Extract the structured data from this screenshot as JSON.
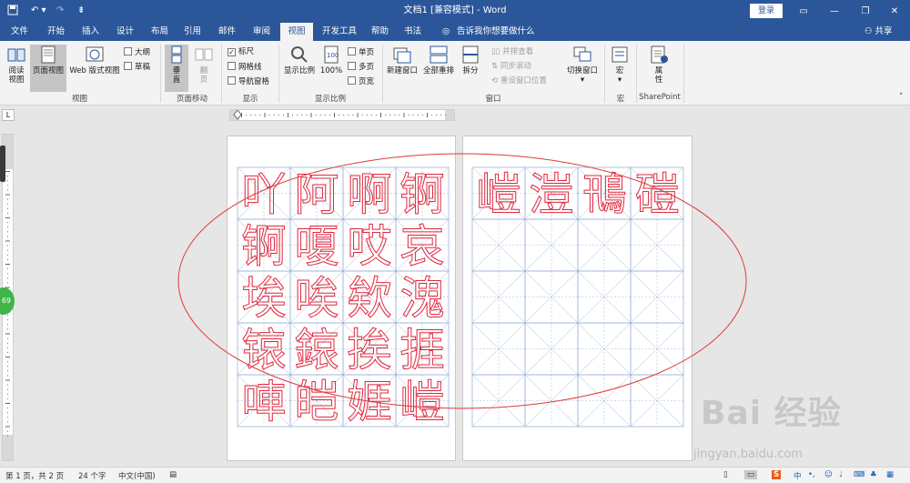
{
  "titlebar": {
    "title": "文档1 [兼容模式] - Word",
    "login": "登录"
  },
  "tabs": [
    "文件",
    "开始",
    "插入",
    "设计",
    "布局",
    "引用",
    "邮件",
    "审阅",
    "视图",
    "开发工具",
    "帮助",
    "书法"
  ],
  "active_tab": "视图",
  "tell_me": "告诉我你想要做什么",
  "share": "共享",
  "ribbon": {
    "views": {
      "read": "阅读\n视图",
      "print": "页面视图",
      "web": "Web 版式视图",
      "outline": "大纲",
      "draft": "草稿",
      "group": "视图"
    },
    "page_move": {
      "vertical": "垂\n直",
      "side": "翻\n页",
      "group": "页面移动"
    },
    "show": {
      "ruler": "标尺",
      "grid": "网格线",
      "nav": "导航窗格",
      "group": "显示"
    },
    "zoom": {
      "zoom": "显示比例",
      "hundred": "100%",
      "one_page": "单页",
      "multi_page": "多页",
      "page_width": "页宽",
      "group": "显示比例"
    },
    "window": {
      "new": "新建窗口",
      "arrange": "全部重排",
      "split": "拆分",
      "side_by_side": "并排查看",
      "sync": "同步滚动",
      "reset": "重设窗口位置",
      "switch": "切换窗口",
      "group": "窗口"
    },
    "macro": {
      "label": "宏",
      "group": "宏"
    },
    "sharepoint": {
      "label": "属\n性",
      "group": "SharePoint"
    }
  },
  "page1_chars": [
    [
      "吖",
      "阿",
      "啊",
      "锕"
    ],
    [
      "锕",
      "嗄",
      "哎",
      "哀"
    ],
    [
      "埃",
      "唉",
      "欸",
      "溾"
    ],
    [
      "锿",
      "鎄",
      "挨",
      "捱"
    ],
    [
      "唓",
      "皑",
      "娾",
      "嵦"
    ]
  ],
  "page2_chars": [
    "嵦",
    "溰",
    "鳵",
    "磑"
  ],
  "status": {
    "page": "第 1 页，共 2 页",
    "words": "24 个字",
    "lang": "中文(中国)"
  },
  "badge": "69",
  "watermark": {
    "main": "Bai 经验",
    "url": "jingyan.baidu.com"
  },
  "colors": {
    "accent": "#2b579a",
    "char_red": "#e0283c",
    "grid_blue": "#9fb7d6"
  }
}
